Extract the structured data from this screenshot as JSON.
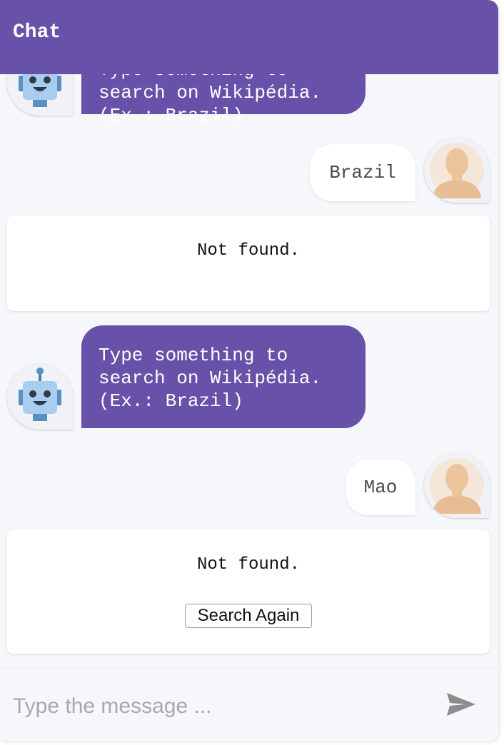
{
  "header": {
    "title": "Chat"
  },
  "messages": [
    {
      "type": "bot",
      "text": "Type something to\nsearch on Wikipédia.\n(Ex.: Brazil)"
    },
    {
      "type": "user",
      "text": "Brazil"
    },
    {
      "type": "result",
      "text": "Not found."
    },
    {
      "type": "bot",
      "text": "Type something to\nsearch on Wikipédia.\n(Ex.: Brazil)"
    },
    {
      "type": "user",
      "text": "Mao"
    },
    {
      "type": "result",
      "text": "Not found.",
      "button_label": "Search Again"
    }
  ],
  "input": {
    "placeholder": "Type the message ..."
  },
  "icons": {
    "send": "send-icon",
    "bot": "robot-icon",
    "user": "user-avatar-icon"
  },
  "colors": {
    "accent": "#6851a8",
    "background": "#f6f7fb"
  }
}
